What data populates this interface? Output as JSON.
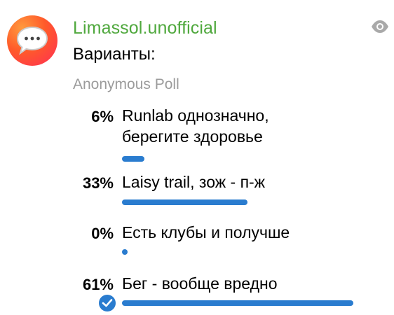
{
  "channel": {
    "name": "Limassol.unofficial"
  },
  "poll": {
    "question": "Варианты:",
    "type": "Anonymous Poll",
    "options": [
      {
        "percent_label": "6%",
        "text": "Runlab однозначно, берегите здоровье",
        "fraction": 0.06,
        "selected": false
      },
      {
        "percent_label": "33%",
        "text": "Laisy trail, зож - п-ж",
        "fraction": 0.33,
        "selected": false
      },
      {
        "percent_label": "0%",
        "text": "Есть клубы и получше",
        "fraction": 0.0,
        "selected": false
      },
      {
        "percent_label": "61%",
        "text": "Бег - вообще вредно",
        "fraction": 0.61,
        "selected": true
      }
    ]
  },
  "colors": {
    "channel_name": "#4fa83d",
    "bar": "#2a7ccf",
    "muted": "#9b9b9b"
  },
  "icons": {
    "avatar": "chat-bubble-icon",
    "views": "eye-icon",
    "selected": "checkmark-icon"
  }
}
